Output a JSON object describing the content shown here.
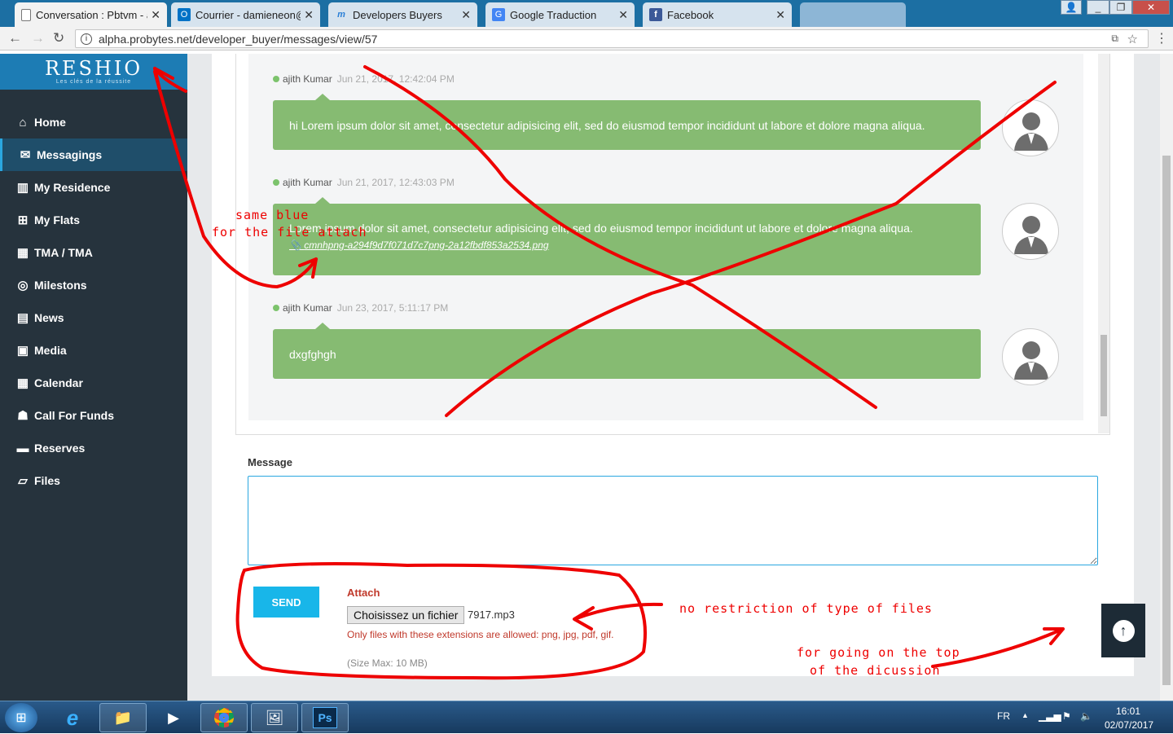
{
  "browser": {
    "tabs": [
      {
        "label": "Conversation : Pbtvm - a",
        "icon": "page-icon",
        "active": true
      },
      {
        "label": "Courrier - damieneon@h",
        "icon": "outlook-icon",
        "active": false
      },
      {
        "label": "Developers Buyers",
        "icon": "m-logo-icon",
        "active": false
      },
      {
        "label": "Google Traduction",
        "icon": "google-translate-icon",
        "active": false
      },
      {
        "label": "Facebook",
        "icon": "facebook-icon",
        "active": false
      }
    ],
    "url": "alpha.probytes.net/developer_buyer/messages/view/57"
  },
  "sidebar": {
    "logo": "RESHIO",
    "logo_tagline": "Les clés de la réussite",
    "items": [
      {
        "label": "Home",
        "icon": "home-icon"
      },
      {
        "label": "Messagings",
        "icon": "envelope-icon",
        "active": true
      },
      {
        "label": "My Residence",
        "icon": "building-icon"
      },
      {
        "label": "My Flats",
        "icon": "grid-icon"
      },
      {
        "label": "TMA / TMA",
        "icon": "tma-icon"
      },
      {
        "label": "Milestons",
        "icon": "milestone-icon"
      },
      {
        "label": "News",
        "icon": "newspaper-icon"
      },
      {
        "label": "Media",
        "icon": "image-icon"
      },
      {
        "label": "Calendar",
        "icon": "calendar-icon"
      },
      {
        "label": "Call For Funds",
        "icon": "funds-icon"
      },
      {
        "label": "Reserves",
        "icon": "reserves-icon"
      },
      {
        "label": "Files",
        "icon": "folder-icon"
      }
    ]
  },
  "messages": [
    {
      "author": "ajith Kumar",
      "time": "Jun 21, 2017, 12:42:04 PM",
      "text": "hi Lorem ipsum dolor sit amet, consectetur adipisicing elit, sed do eiusmod tempor incididunt ut labore et dolore magna aliqua.",
      "attachment": ""
    },
    {
      "author": "ajith Kumar",
      "time": "Jun 21, 2017, 12:43:03 PM",
      "text": "Lorem ipsum dolor sit amet, consectetur adipisicing elit, sed do eiusmod tempor incididunt ut labore et dolore magna aliqua.",
      "attachment": "cmnhpng-a294f9d7f071d7c7png-2a12fbdf853a2534.png"
    },
    {
      "author": "ajith Kumar",
      "time": "Jun 23, 2017, 5:11:17 PM",
      "text": "dxgfghgh",
      "attachment": ""
    }
  ],
  "form": {
    "message_label": "Message",
    "send_label": "SEND",
    "attach_label": "Attach",
    "file_button": "Choisissez un fichier",
    "file_name": "7917.mp3",
    "extensions_hint": "Only files with these extensions are allowed: png, jpg, pdf, gif.",
    "size_hint": "(Size Max: 10 MB)"
  },
  "annotations": {
    "same_blue_1": "same blue",
    "same_blue_2": "for the file attach",
    "no_restriction": "no restriction of type of files",
    "go_top_1": "for going on the top",
    "go_top_2": "of the dicussion",
    "color": "#e00000"
  },
  "taskbar": {
    "lang": "FR",
    "time": "16:01",
    "date": "02/07/2017"
  }
}
